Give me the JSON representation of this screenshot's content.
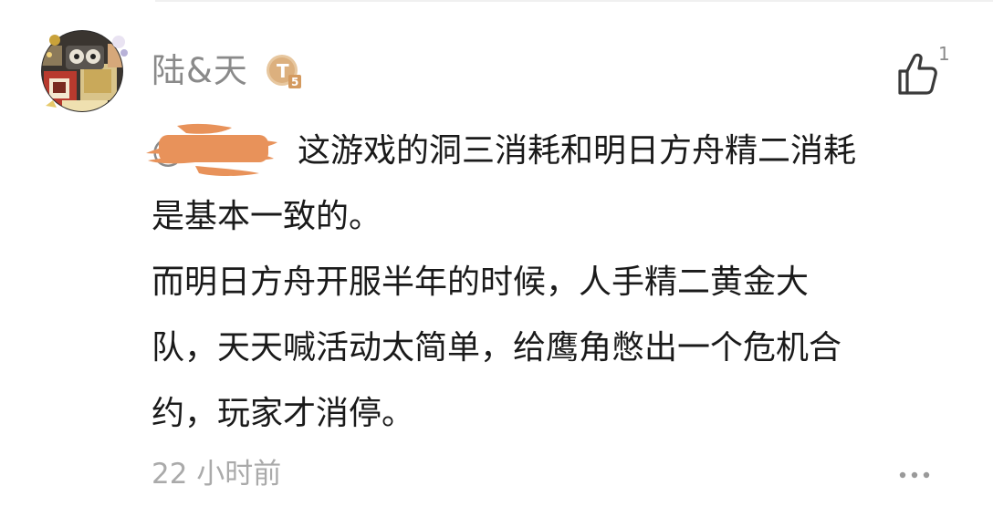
{
  "comment": {
    "author": {
      "name": "陆&天",
      "level_badge": "T5",
      "avatar_icon": "robot-collage-avatar"
    },
    "like": {
      "icon": "thumbs-up-icon",
      "count": "1"
    },
    "mention": {
      "prefix": "@",
      "redaction_color": "#e8925a"
    },
    "body_lines": [
      "这游戏的洞三消耗和明日方舟精二消耗",
      "是基本一致的。",
      "而明日方舟开服半年的时候，人手精二黄金大",
      "队，天天喊活动太简单，给鹰角憋出一个危机合",
      "约，玩家才消停。"
    ],
    "timestamp": "22 小时前",
    "more_icon": "more-dots-icon"
  },
  "colors": {
    "text_primary": "#1a1a1a",
    "text_secondary": "#8a8a8a",
    "text_muted": "#aaaaaa",
    "badge": "#e2b98a"
  }
}
